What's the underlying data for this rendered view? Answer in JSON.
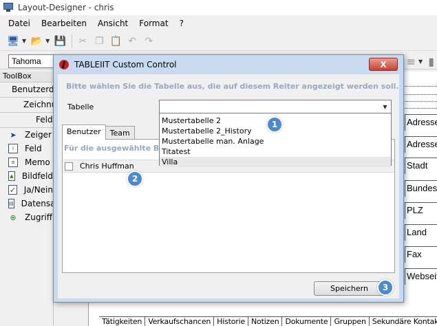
{
  "window": {
    "title": "Layout-Designer - chris"
  },
  "menu": [
    "Datei",
    "Bearbeiten",
    "Ansicht",
    "Format",
    "?"
  ],
  "font": {
    "name": "Tahoma"
  },
  "toolbox": {
    "header": "ToolBox",
    "buttons": [
      "Benutzerdef.",
      "Zeichnung",
      "Felder"
    ],
    "items": [
      "Zeiger",
      "Feld",
      "Memo",
      "Bildfeld",
      "Ja/Nein",
      "Datensatz",
      "Zugriff"
    ]
  },
  "form_fields": [
    "Adresse",
    "Adresse",
    "Stadt",
    "Bundesland",
    "PLZ",
    "Land",
    "Fax",
    "Webseite"
  ],
  "bottom_tabs": [
    "Tätigkeiten",
    "Verkaufschancen",
    "Historie",
    "Notizen",
    "Dokumente",
    "Gruppen",
    "Sekundäre Kontakte"
  ],
  "dialog": {
    "title": "TABLEIIT Custom Control",
    "close": "X",
    "hint": "Bitte wählen Sie die Tabelle aus, die auf diesem Reiter angezeigt werden soll.",
    "table_label": "Tabelle",
    "table_value": "",
    "options": [
      "Mustertabelle 2",
      "Mustertabelle 2_History",
      "Mustertabelle man. Anlage",
      "Titatest",
      "Villa"
    ],
    "tabs": [
      "Benutzer",
      "Team"
    ],
    "panel_hint": "Für die ausgewählte Benutzer",
    "users": [
      "Chris Huffman"
    ],
    "save_label": "Speichern"
  },
  "callouts": [
    "1",
    "2",
    "3"
  ]
}
